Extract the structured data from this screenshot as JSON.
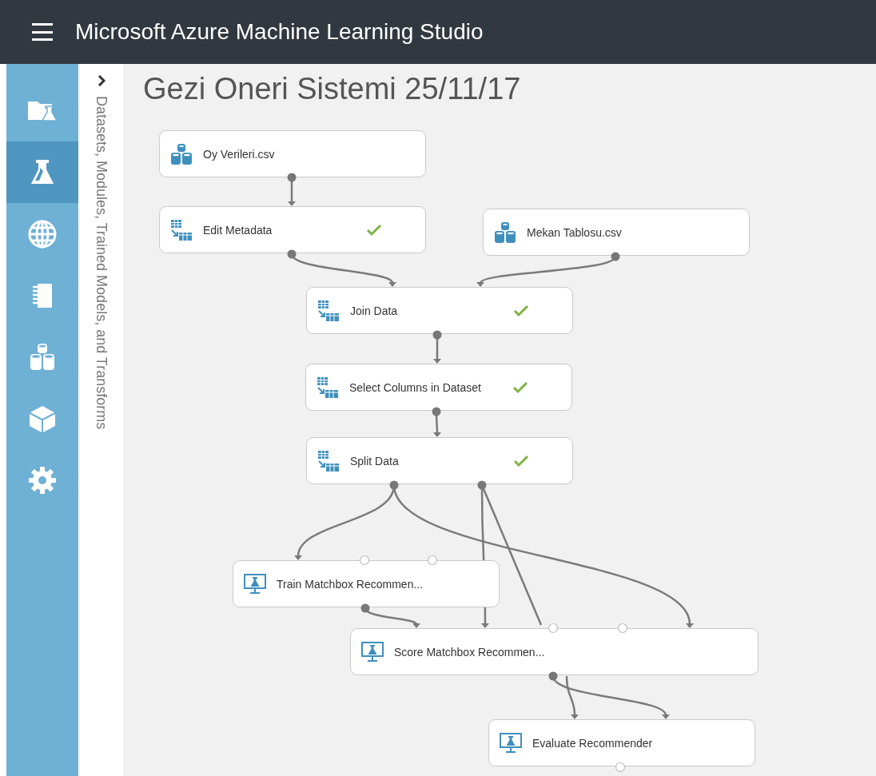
{
  "app_bar": {
    "title": "Microsoft Azure Machine Learning Studio"
  },
  "sidebar": {
    "items": [
      {
        "kind": "projects",
        "selected": false
      },
      {
        "kind": "experiments",
        "selected": true
      },
      {
        "kind": "web-services",
        "selected": false
      },
      {
        "kind": "notebooks",
        "selected": false
      },
      {
        "kind": "datasets",
        "selected": false
      },
      {
        "kind": "trained-models",
        "selected": false
      },
      {
        "kind": "settings",
        "selected": false
      }
    ]
  },
  "palette": {
    "label": "Datasets, Modules, Trained Models, and Transforms"
  },
  "experiment": {
    "title": "Gezi Oneri Sistemi 25/11/17",
    "nodes": [
      {
        "kind": "dataset",
        "label": "Oy Verileri.csv",
        "done": false
      },
      {
        "kind": "module",
        "label": "Edit Metadata",
        "done": true
      },
      {
        "kind": "dataset",
        "label": "Mekan Tablosu.csv",
        "done": false
      },
      {
        "kind": "module",
        "label": "Join Data",
        "done": true
      },
      {
        "kind": "module",
        "label": "Select Columns in Dataset",
        "done": true
      },
      {
        "kind": "module",
        "label": "Split Data",
        "done": true
      },
      {
        "kind": "model",
        "label": "Train Matchbox Recommen...",
        "done": false
      },
      {
        "kind": "model",
        "label": "Score Matchbox Recommen...",
        "done": false
      },
      {
        "kind": "model",
        "label": "Evaluate Recommender",
        "done": false
      }
    ]
  }
}
